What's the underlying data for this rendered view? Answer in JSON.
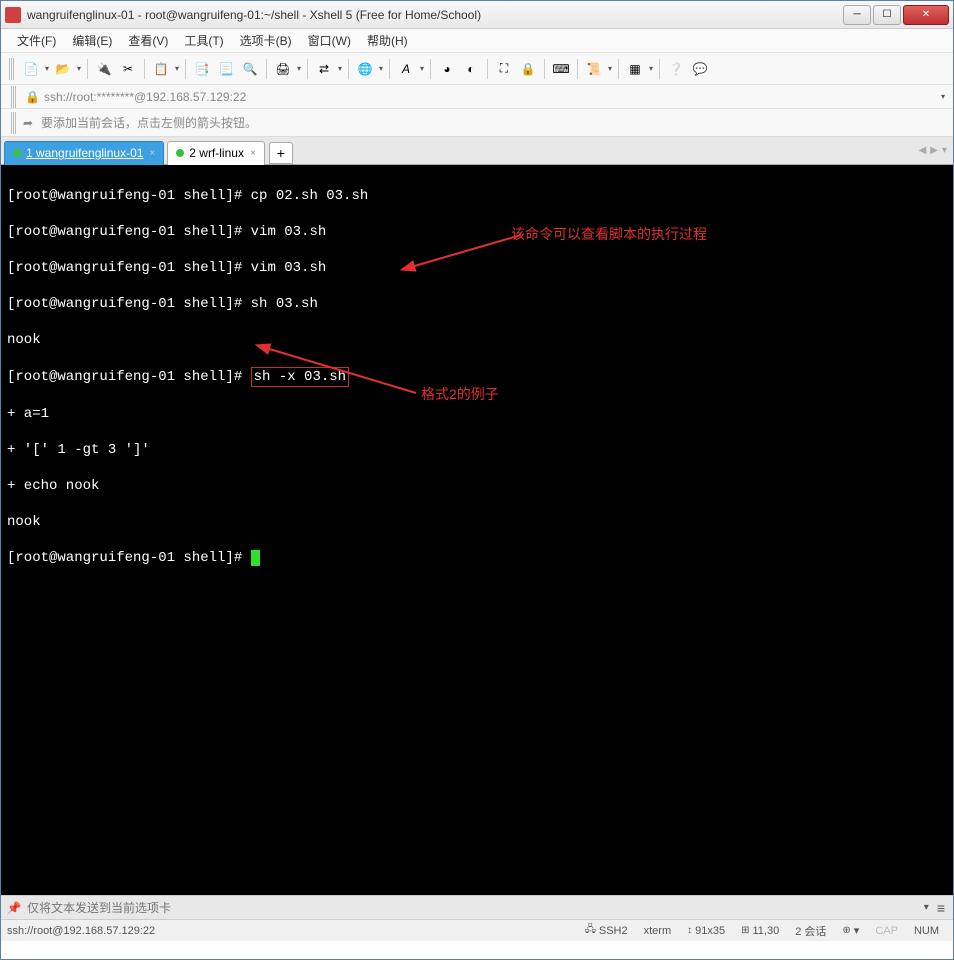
{
  "window": {
    "title": "wangruifenglinux-01 - root@wangruifeng-01:~/shell - Xshell 5 (Free for Home/School)"
  },
  "menu": {
    "file": "文件(F)",
    "edit": "编辑(E)",
    "view": "查看(V)",
    "tools": "工具(T)",
    "tabs": "选项卡(B)",
    "window": "窗口(W)",
    "help": "帮助(H)"
  },
  "address": {
    "text": "ssh://root:********@192.168.57.129:22"
  },
  "info": {
    "text": "要添加当前会话，点击左侧的箭头按钮。"
  },
  "tabs": {
    "tab1": "1 wangruifenglinux-01",
    "tab2": "2 wrf-linux"
  },
  "terminal": {
    "l1": "[root@wangruifeng-01 shell]# cp 02.sh 03.sh",
    "l2": "[root@wangruifeng-01 shell]# vim 03.sh",
    "l3": "[root@wangruifeng-01 shell]# vim 03.sh",
    "l4": "[root@wangruifeng-01 shell]# sh 03.sh",
    "l5": "nook",
    "l6a": "[root@wangruifeng-01 shell]# ",
    "l6b": "sh -x 03.sh",
    "l7": "+ a=1",
    "l8": "+ '[' 1 -gt 3 ']'",
    "l9": "+ echo nook",
    "l10": "nook",
    "l11": "[root@wangruifeng-01 shell]# "
  },
  "annotations": {
    "a1": "该命令可以查看脚本的执行过程",
    "a2": "格式2的例子"
  },
  "input": {
    "placeholder": "仅将文本发送到当前选项卡"
  },
  "status": {
    "left": "ssh://root@192.168.57.129:22",
    "ssh": "SSH2",
    "term": "xterm",
    "size": "91x35",
    "pos": "11,30",
    "sessions": "2 会话",
    "cap": "CAP",
    "num": "NUM"
  }
}
